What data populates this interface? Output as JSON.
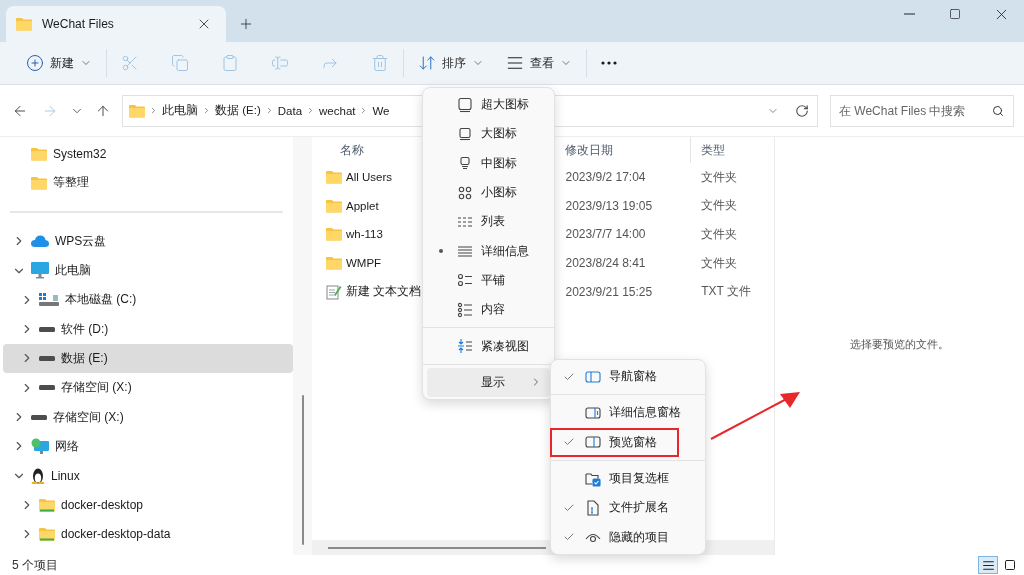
{
  "tab": {
    "title": "WeChat Files"
  },
  "toolbar": [
    [
      {
        "kind": "new",
        "label": "新建",
        "dropdown": true,
        "disabled": false
      }
    ],
    [
      {
        "kind": "cut",
        "dropdown": false,
        "disabled": true
      },
      {
        "kind": "copy",
        "dropdown": false,
        "disabled": true
      },
      {
        "kind": "paste",
        "dropdown": false,
        "disabled": true
      },
      {
        "kind": "rename",
        "dropdown": false,
        "disabled": true
      },
      {
        "kind": "share",
        "dropdown": false,
        "disabled": true
      },
      {
        "kind": "delete",
        "dropdown": false,
        "disabled": true
      }
    ],
    [
      {
        "kind": "sort",
        "label": "排序",
        "dropdown": true,
        "disabled": false
      },
      {
        "kind": "view",
        "label": "查看",
        "dropdown": true,
        "disabled": false
      }
    ],
    [
      {
        "kind": "more",
        "dropdown": false,
        "disabled": false
      }
    ]
  ],
  "address": {
    "crumbs": [
      "此电脑",
      "数据 (E:)",
      "Data",
      "wechat",
      "We"
    ]
  },
  "search": {
    "placeholder": "在 WeChat Files 中搜索"
  },
  "nav": {
    "quick_access": [
      {
        "label": "System32",
        "selected": false
      },
      {
        "label": "等整理",
        "selected": false
      }
    ],
    "tree": [
      {
        "kind": "cloud",
        "label": "WPS云盘",
        "expanded": false,
        "selected": false
      },
      {
        "kind": "pc",
        "label": "此电脑",
        "expanded": true,
        "selected": false,
        "children": [
          {
            "kind": "system-drive",
            "label": "本地磁盘 (C:)",
            "expanded": false,
            "selected": false
          },
          {
            "kind": "drive",
            "label": "软件 (D:)",
            "expanded": false,
            "selected": false
          },
          {
            "kind": "drive",
            "label": "数据 (E:)",
            "expanded": false,
            "selected": true
          },
          {
            "kind": "drive",
            "label": "存储空间 (X:)",
            "expanded": false,
            "selected": false
          }
        ]
      },
      {
        "kind": "drive",
        "label": "存储空间 (X:)",
        "expanded": false,
        "selected": false
      },
      {
        "kind": "network",
        "label": "网络",
        "expanded": false,
        "selected": false
      },
      {
        "kind": "linux",
        "label": "Linux",
        "expanded": true,
        "selected": false,
        "children": [
          {
            "kind": "linux-folder",
            "label": "docker-desktop",
            "expanded": false,
            "selected": false
          },
          {
            "kind": "linux-folder",
            "label": "docker-desktop-data",
            "expanded": false,
            "selected": false
          }
        ]
      }
    ]
  },
  "content": {
    "columns": [
      "名称",
      "修改日期",
      "类型"
    ],
    "rows": [
      {
        "kind": "folder",
        "name": "All Users",
        "date": "2023/9/2 17:04",
        "type": "文件夹"
      },
      {
        "kind": "folder",
        "name": "Applet",
        "date": "2023/9/13 19:05",
        "type": "文件夹"
      },
      {
        "kind": "folder",
        "name": "wh-113",
        "date": "2023/7/7 14:00",
        "type": "文件夹"
      },
      {
        "kind": "folder",
        "name": "WMPF",
        "date": "2023/8/24 8:41",
        "type": "文件夹"
      },
      {
        "kind": "text",
        "name": "新建 文本文档",
        "date": "2023/9/21 15:25",
        "type": "TXT 文件"
      }
    ]
  },
  "preview": {
    "message": "选择要预览的文件。"
  },
  "view_menu": {
    "sections": [
      [
        {
          "kind": "xl",
          "label": "超大图标",
          "selected": false,
          "highlighted": false
        },
        {
          "kind": "large",
          "label": "大图标",
          "selected": false,
          "highlighted": false
        },
        {
          "kind": "medium",
          "label": "中图标",
          "selected": false,
          "highlighted": false
        },
        {
          "kind": "small",
          "label": "小图标",
          "selected": false,
          "highlighted": false
        },
        {
          "kind": "list",
          "label": "列表",
          "selected": false,
          "highlighted": false
        },
        {
          "kind": "details",
          "label": "详细信息",
          "selected": true,
          "highlighted": false
        },
        {
          "kind": "tiles",
          "label": "平铺",
          "selected": false,
          "highlighted": false
        },
        {
          "kind": "content",
          "label": "内容",
          "selected": false,
          "highlighted": false
        }
      ],
      [
        {
          "kind": "compact",
          "label": "紧凑视图",
          "selected": false,
          "highlighted": false
        }
      ],
      [
        {
          "kind": "submenu",
          "label": "显示",
          "selected": false,
          "highlighted": true
        }
      ]
    ]
  },
  "show_menu": {
    "sections": [
      [
        {
          "kind": "nav-pane",
          "label": "导航窗格",
          "checked": true,
          "marked": false
        }
      ],
      [
        {
          "kind": "details-pane",
          "label": "详细信息窗格",
          "checked": false,
          "marked": false
        },
        {
          "kind": "preview-pane",
          "label": "预览窗格",
          "checked": true,
          "marked": true
        }
      ],
      [
        {
          "kind": "checkboxes",
          "label": "项目复选框",
          "checked": false,
          "marked": false
        },
        {
          "kind": "extensions",
          "label": "文件扩展名",
          "checked": true,
          "marked": false
        },
        {
          "kind": "hidden",
          "label": "隐藏的项目",
          "checked": true,
          "marked": false
        }
      ]
    ]
  },
  "arrow_annotation": true,
  "status_bar": {
    "count": "5 个项目",
    "views": [
      {
        "kind": "details",
        "selected": true
      },
      {
        "kind": "tiles",
        "selected": false
      }
    ]
  }
}
